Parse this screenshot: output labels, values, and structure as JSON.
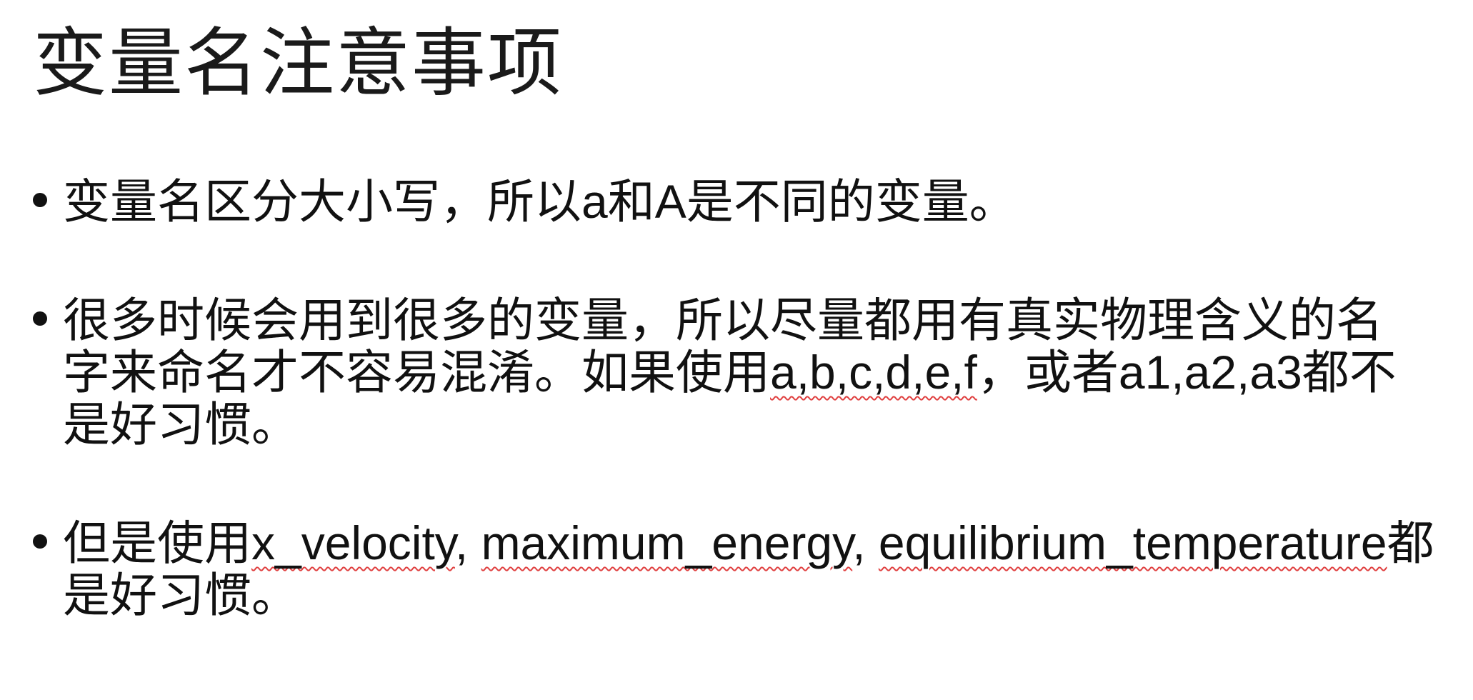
{
  "slide": {
    "title": "变量名注意事项",
    "bullets": [
      {
        "lines": [
          {
            "pre": "变量名区分大小写，所以",
            "code": "a",
            "mid": "和",
            "code2": "A",
            "post": "是不同的变量。"
          }
        ]
      },
      {
        "lines": [
          {
            "text": "很多时候会用到很多的变量，所以尽量都用有真实物理含义的名"
          },
          {
            "pre": "字来命名才不容易混淆。如果使用",
            "code": "a,b,c,d,e,f",
            "mid": "，或者",
            "code2": "a1,a2,a3",
            "post": "都不"
          },
          {
            "text": "是好习惯。"
          }
        ]
      },
      {
        "lines": [
          {
            "pre": "但是使用",
            "code": "x_velocity",
            "mid": ", ",
            "code2": "maximum_energy",
            "mid2": ", ",
            "code3": "equilibrium_temperature",
            "post": "都"
          },
          {
            "text": "是好习惯。"
          }
        ]
      }
    ]
  }
}
